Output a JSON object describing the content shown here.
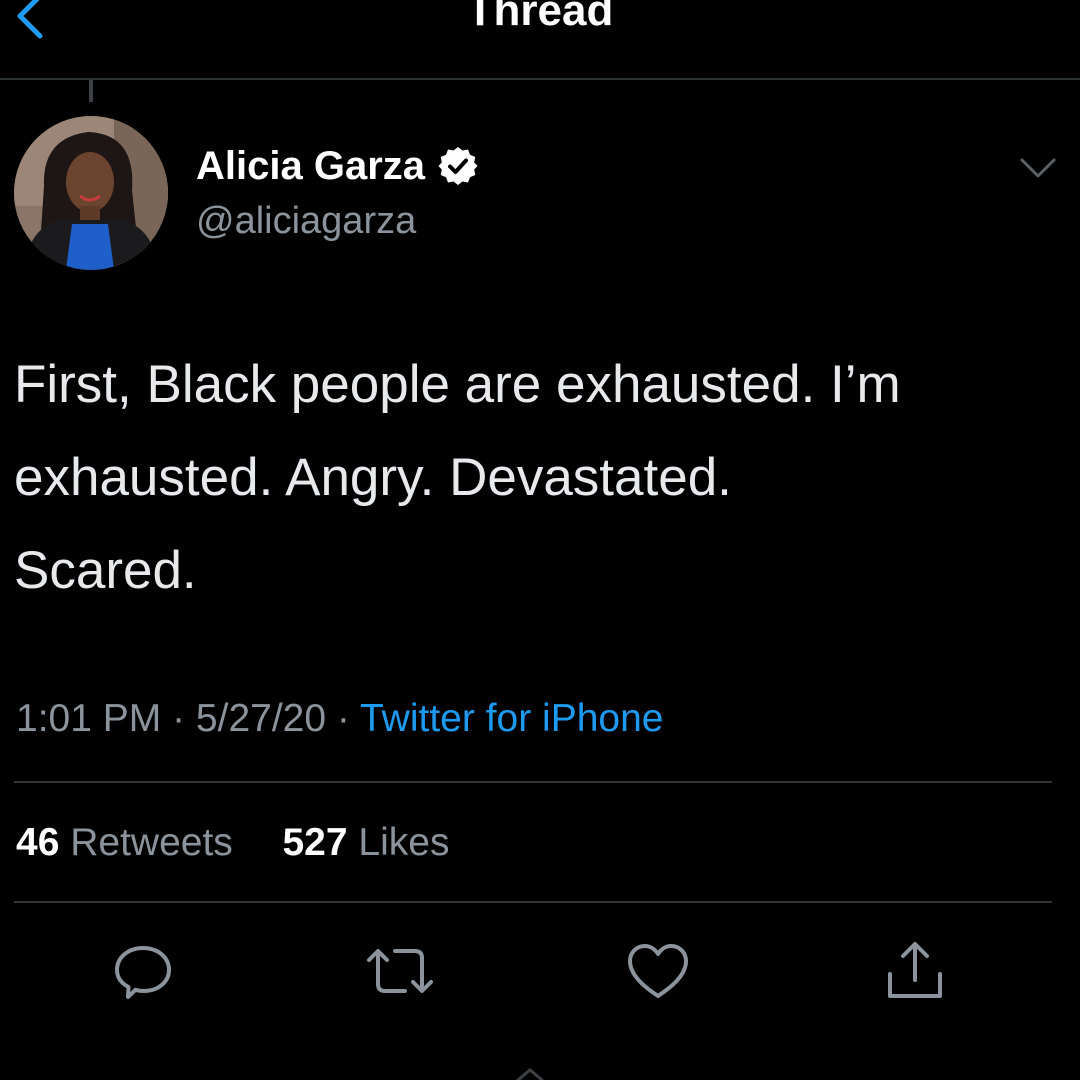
{
  "header": {
    "title": "Thread",
    "back_icon": "chevron-left-icon"
  },
  "tweet": {
    "author": {
      "display_name": "Alicia Garza",
      "handle": "@aliciagarza",
      "verified": true
    },
    "text": "First, Black people are exhausted. I’m\nexhausted. Angry. Devastated.\nScared.",
    "meta": {
      "time": "1:01 PM",
      "sep1": " · ",
      "date": "5/27/20",
      "sep2": " · ",
      "source": "Twitter for iPhone"
    },
    "stats": {
      "retweets_count": "46",
      "retweets_label": " Retweets",
      "likes_count": "527",
      "likes_label": " Likes"
    },
    "actions": [
      {
        "name": "reply",
        "icon": "reply-icon"
      },
      {
        "name": "retweet",
        "icon": "retweet-icon"
      },
      {
        "name": "like",
        "icon": "heart-icon"
      },
      {
        "name": "share",
        "icon": "share-icon"
      }
    ]
  },
  "colors": {
    "background": "#000000",
    "text_primary": "#ffffff",
    "text_secondary": "#8b949c",
    "accent": "#1d9bf0",
    "divider": "#2f3336"
  }
}
